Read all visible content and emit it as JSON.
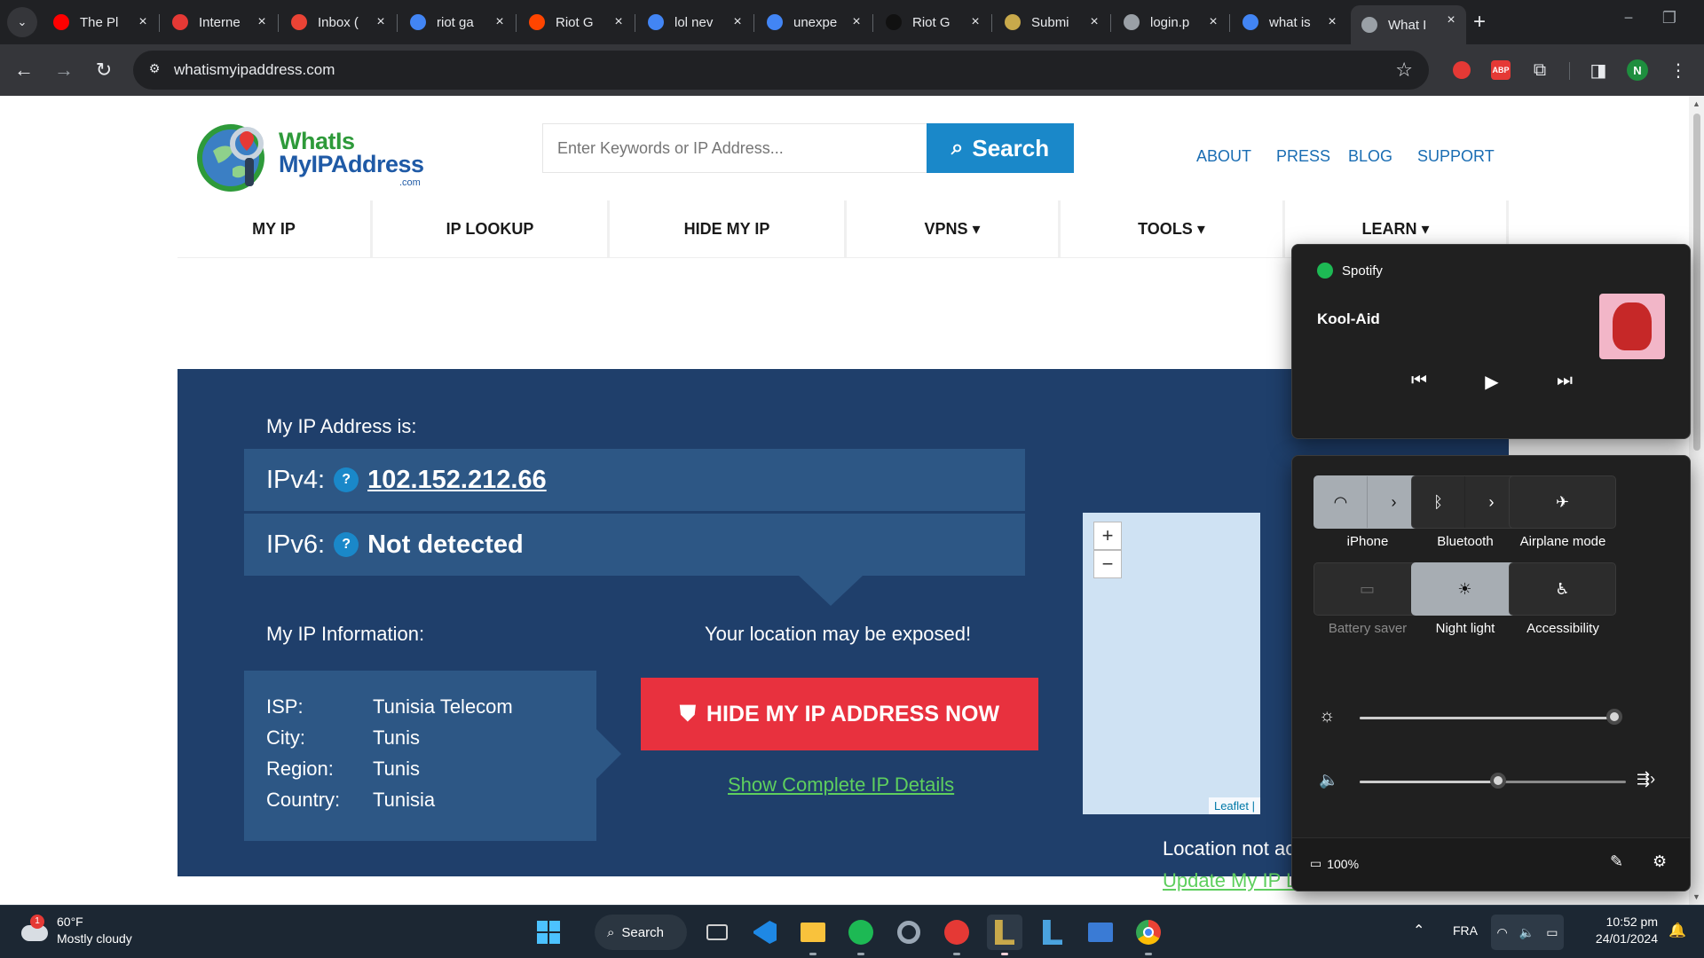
{
  "browser": {
    "tabs": [
      {
        "title": "The Pl",
        "favicon": "youtube-icon",
        "color": "#ff0000"
      },
      {
        "title": "Interne",
        "favicon": "speedometer-icon",
        "color": "#e53935"
      },
      {
        "title": "Inbox (",
        "favicon": "gmail-icon",
        "color": "#ea4335"
      },
      {
        "title": "riot ga",
        "favicon": "google-icon",
        "color": "#4285f4"
      },
      {
        "title": "Riot G",
        "favicon": "reddit-icon",
        "color": "#ff4500"
      },
      {
        "title": "lol nev",
        "favicon": "google-icon",
        "color": "#4285f4"
      },
      {
        "title": "unexpe",
        "favicon": "google-icon",
        "color": "#4285f4"
      },
      {
        "title": "Riot G",
        "favicon": "riot-icon",
        "color": "#111111"
      },
      {
        "title": "Submi",
        "favicon": "submit-icon",
        "color": "#c8a94b"
      },
      {
        "title": "login.p",
        "favicon": "globe-icon",
        "color": "#9aa0a6"
      },
      {
        "title": "what is",
        "favicon": "google-icon",
        "color": "#4285f4"
      },
      {
        "title": "What I",
        "favicon": "globe-icon",
        "color": "#9aa0a6",
        "active": true
      }
    ],
    "url": "whatismyipaddress.com",
    "profile_initial": "N",
    "extensions": {
      "abp": "ABP"
    }
  },
  "site": {
    "logo": {
      "line1": "WhatIs",
      "line2": "MyIPAddress",
      "suffix": ".com"
    },
    "search": {
      "placeholder": "Enter Keywords or IP Address...",
      "button": "Search"
    },
    "top_links": [
      "ABOUT",
      "PRESS",
      "BLOG",
      "SUPPORT"
    ],
    "nav": [
      "MY IP",
      "IP LOOKUP",
      "HIDE MY IP",
      "VPNS ▾",
      "TOOLS ▾",
      "LEARN ▾"
    ],
    "hero": {
      "my_ip_label": "My IP Address is:",
      "ipv4_label": "IPv4:",
      "ipv4_value": "102.152.212.66",
      "ipv6_label": "IPv6:",
      "ipv6_value": "Not detected",
      "qmark": "?",
      "info_label": "My IP Information:",
      "info": [
        {
          "key": "ISP:",
          "value": "Tunisia Telecom"
        },
        {
          "key": "City:",
          "value": "Tunis"
        },
        {
          "key": "Region:",
          "value": "Tunis"
        },
        {
          "key": "Country:",
          "value": "Tunisia"
        }
      ],
      "exposed_text": "Your location may be exposed!",
      "hide_button": "HIDE MY IP ADDRESS NOW",
      "details_link": "Show Complete IP Details",
      "map_attribution": "Leaflet |",
      "zoom_in": "+",
      "zoom_out": "−",
      "location_text": "Location not ac",
      "update_link": "Update My IP L"
    }
  },
  "media_flyout": {
    "app": "Spotify",
    "track": "Kool-Aid"
  },
  "quick_settings": {
    "tiles": [
      {
        "label": "iPhone",
        "icon": "wifi-icon",
        "on": true
      },
      {
        "label": "Bluetooth",
        "icon": "bluetooth-icon",
        "on": false
      },
      {
        "label": "Airplane mode",
        "icon": "airplane-icon",
        "on": false
      },
      {
        "label": "Battery saver",
        "icon": "battery-saver-icon",
        "on": false,
        "disabled": true
      },
      {
        "label": "Night light",
        "icon": "night-light-icon",
        "on": true
      },
      {
        "label": "Accessibility",
        "icon": "accessibility-icon",
        "on": false
      }
    ],
    "brightness_level": 0.99,
    "volume_level": 0.52,
    "battery": "100%"
  },
  "taskbar": {
    "weather_temp": "60°F",
    "weather_desc": "Mostly cloudy",
    "weather_badge": "1",
    "search_label": "Search",
    "language": "FRA",
    "time": "10:52 pm",
    "date": "24/01/2024"
  }
}
